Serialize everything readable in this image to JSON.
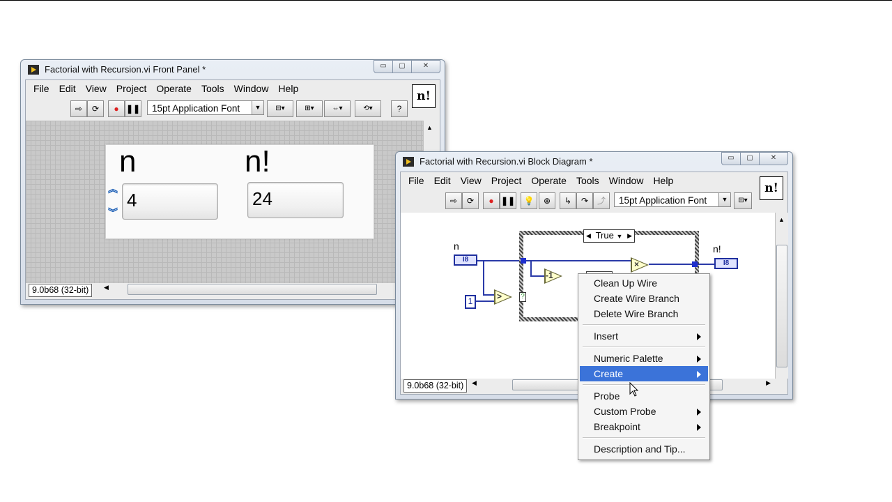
{
  "front_panel": {
    "title": "Factorial with Recursion.vi Front Panel *",
    "menu": [
      "File",
      "Edit",
      "View",
      "Project",
      "Operate",
      "Tools",
      "Window",
      "Help"
    ],
    "vi_icon_text": "n!",
    "font_selector": "15pt Application Font",
    "status": "9.0b68 (32-bit)",
    "controls": {
      "n_label": "n",
      "n_value": "4",
      "nfact_label": "n!",
      "nfact_value": "24"
    },
    "window_controls": {
      "minimize": "▭",
      "maximize": "▢",
      "close": "✕"
    }
  },
  "block_diagram": {
    "title": "Factorial with Recursion.vi Block Diagram *",
    "menu": [
      "File",
      "Edit",
      "View",
      "Project",
      "Operate",
      "Tools",
      "Window",
      "Help"
    ],
    "vi_icon_text": "n!",
    "font_selector": "15pt Application Font",
    "status": "9.0b68 (32-bit)",
    "window_controls": {
      "minimize": "▭",
      "maximize": "▢",
      "close": "✕"
    },
    "diagram": {
      "input_label": "n",
      "input_terminal": "I8",
      "output_label": "n!",
      "output_terminal": "I8",
      "constant": "1",
      "case_selector": "True",
      "greater_symbol": ">",
      "decrement_symbol": "-1",
      "multiply_symbol": "×",
      "case_selector_terminal": "?"
    }
  },
  "context_menu": {
    "items": [
      {
        "label": "Clean Up Wire",
        "submenu": false
      },
      {
        "label": "Create Wire Branch",
        "submenu": false
      },
      {
        "label": "Delete Wire Branch",
        "submenu": false
      },
      {
        "label": "Insert",
        "submenu": true
      },
      {
        "label": "Numeric Palette",
        "submenu": true
      },
      {
        "label": "Create",
        "submenu": true,
        "selected": true
      },
      {
        "label": "Probe",
        "submenu": false
      },
      {
        "label": "Custom Probe",
        "submenu": true
      },
      {
        "label": "Breakpoint",
        "submenu": true
      },
      {
        "label": "Description and Tip...",
        "submenu": false
      }
    ]
  },
  "colors": {
    "wire": "#2a3aa8",
    "menu_highlight": "#3b73d9"
  }
}
